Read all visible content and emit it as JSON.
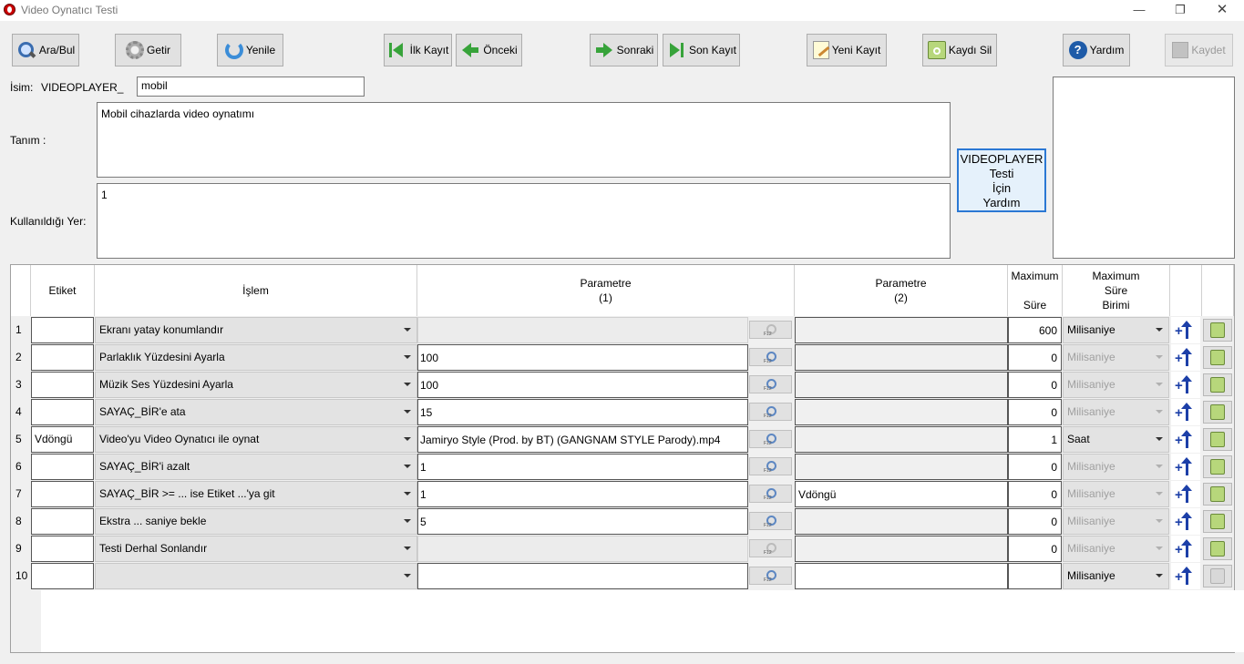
{
  "window": {
    "title": "Video Oynatıcı Testi"
  },
  "toolbar": {
    "search": "Ara/Bul",
    "fetch": "Getir",
    "refresh": "Yenile",
    "first": "İlk Kayıt",
    "prev": "Önceki",
    "next": "Sonraki",
    "last": "Son Kayıt",
    "new": "Yeni Kayıt",
    "delete": "Kaydı Sil",
    "help": "Yardım",
    "save": "Kaydet"
  },
  "form": {
    "name_label": "İsim:",
    "name_prefix": "VIDEOPLAYER_",
    "name_value": "mobil",
    "desc_label": "Tanım :",
    "desc_value": "Mobil cihazlarda video oynatımı",
    "used_label": "Kullanıldığı Yer:",
    "used_value": "1",
    "help_box": [
      "VIDEOPLAYER",
      "Testi",
      "İçin",
      "Yardım"
    ]
  },
  "grid": {
    "headers": {
      "tag": "Etiket",
      "op": "İşlem",
      "p1_line1": "Parametre",
      "p1_line2": "(1)",
      "p2_line1": "Parametre",
      "p2_line2": "(2)",
      "max_line1": "Maximum",
      "max_line2": "Süre",
      "unit_line1": "Maximum",
      "unit_line2": "Süre",
      "unit_line3": "Birimi"
    },
    "rows": [
      {
        "n": "1",
        "tag": "",
        "op": "Ekranı yatay konumlandır",
        "p1": "",
        "p1_on": false,
        "p2": "",
        "p2_on": false,
        "max": "600",
        "unit": "Milisaniye",
        "unit_on": true,
        "del_on": true
      },
      {
        "n": "2",
        "tag": "",
        "op": "Parlaklık Yüzdesini Ayarla",
        "p1": "100",
        "p1_on": true,
        "p2": "",
        "p2_on": false,
        "max": "0",
        "unit": "Milisaniye",
        "unit_on": false,
        "del_on": true
      },
      {
        "n": "3",
        "tag": "",
        "op": "Müzik Ses Yüzdesini Ayarla",
        "p1": "100",
        "p1_on": true,
        "p2": "",
        "p2_on": false,
        "max": "0",
        "unit": "Milisaniye",
        "unit_on": false,
        "del_on": true
      },
      {
        "n": "4",
        "tag": "",
        "op": "SAYAÇ_BİR'e ata",
        "p1": "15",
        "p1_on": true,
        "p2": "",
        "p2_on": false,
        "max": "0",
        "unit": "Milisaniye",
        "unit_on": false,
        "del_on": true
      },
      {
        "n": "5",
        "tag": "Vdöngü",
        "op": "Video'yu Video Oynatıcı ile oynat",
        "p1": "Jamiryo Style (Prod. by BT) (GANGNAM STYLE Parody).mp4",
        "p1_on": true,
        "p2": "",
        "p2_on": false,
        "max": "1",
        "unit": "Saat",
        "unit_on": true,
        "del_on": true
      },
      {
        "n": "6",
        "tag": "",
        "op": "SAYAÇ_BİR'i azalt",
        "p1": "1",
        "p1_on": true,
        "p2": "",
        "p2_on": false,
        "max": "0",
        "unit": "Milisaniye",
        "unit_on": false,
        "del_on": true
      },
      {
        "n": "7",
        "tag": "",
        "op": "SAYAÇ_BİR >= ... ise Etiket ...'ya git",
        "p1": "1",
        "p1_on": true,
        "p2": "Vdöngü",
        "p2_on": true,
        "max": "0",
        "unit": "Milisaniye",
        "unit_on": false,
        "del_on": true
      },
      {
        "n": "8",
        "tag": "",
        "op": "Ekstra ... saniye bekle",
        "p1": "5",
        "p1_on": true,
        "p2": "",
        "p2_on": false,
        "max": "0",
        "unit": "Milisaniye",
        "unit_on": false,
        "del_on": true
      },
      {
        "n": "9",
        "tag": "",
        "op": "Testi Derhal Sonlandır",
        "p1": "",
        "p1_on": false,
        "p2": "",
        "p2_on": false,
        "max": "0",
        "unit": "Milisaniye",
        "unit_on": false,
        "del_on": true
      },
      {
        "n": "10",
        "tag": "",
        "op": "",
        "p1": "",
        "p1_on": true,
        "p2": "",
        "p2_on": true,
        "max": "",
        "unit": "Milisaniye",
        "unit_on": true,
        "del_on": false
      }
    ]
  }
}
